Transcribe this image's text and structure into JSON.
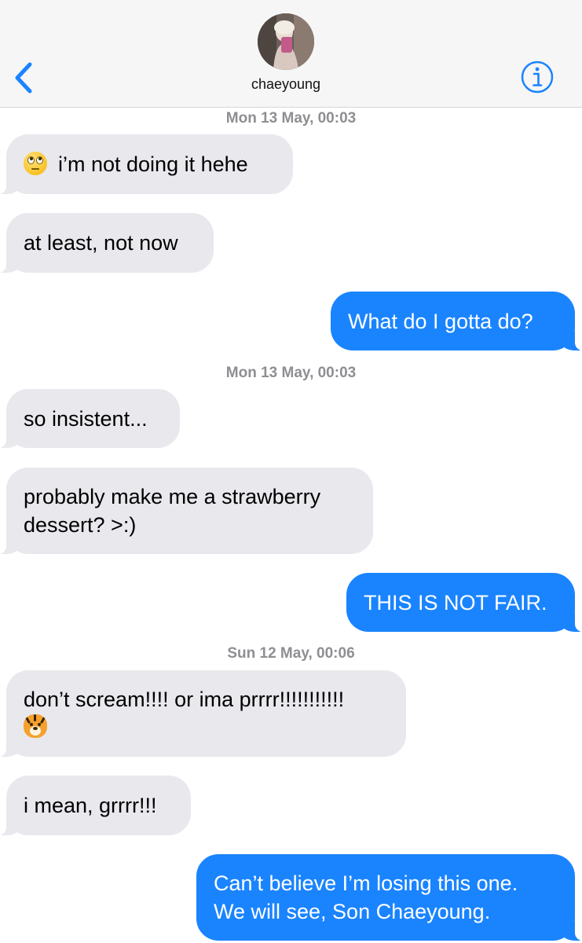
{
  "header": {
    "contact_name": "chaeyoung",
    "back_icon": "chevron-left-icon",
    "info_icon": "info-icon",
    "accent_color": "#1a84ff"
  },
  "timestamps": [
    "Mon 13 May, 00:03",
    "Mon 13 May, 00:03",
    "Sun 12 May, 00:06"
  ],
  "messages": [
    {
      "from": "them",
      "lines": [
        "i’m not doing it hehe"
      ],
      "emoji": "face-with-rolling-eyes"
    },
    {
      "from": "them",
      "lines": [
        "at least, not now"
      ]
    },
    {
      "from": "me",
      "lines": [
        "What do I gotta do?"
      ]
    },
    {
      "from": "them",
      "lines": [
        "so insistent..."
      ]
    },
    {
      "from": "them",
      "lines": [
        "probably make me a strawberry",
        "dessert? >:)"
      ]
    },
    {
      "from": "me",
      "lines": [
        "THIS IS NOT FAIR."
      ]
    },
    {
      "from": "them",
      "lines": [
        "don’t scream!!!! or ima prrrr!!!!!!!!!!!"
      ],
      "emoji": "tiger-face"
    },
    {
      "from": "them",
      "lines": [
        "i mean, grrrr!!!"
      ]
    },
    {
      "from": "me",
      "lines": [
        "Can’t believe I’m losing this one.",
        "We will see, Son Chaeyoung."
      ]
    }
  ],
  "colors": {
    "incoming_bubble": "#e8e8ed",
    "outgoing_bubble": "#1a84ff",
    "timestamp_text": "#8e8e93"
  }
}
